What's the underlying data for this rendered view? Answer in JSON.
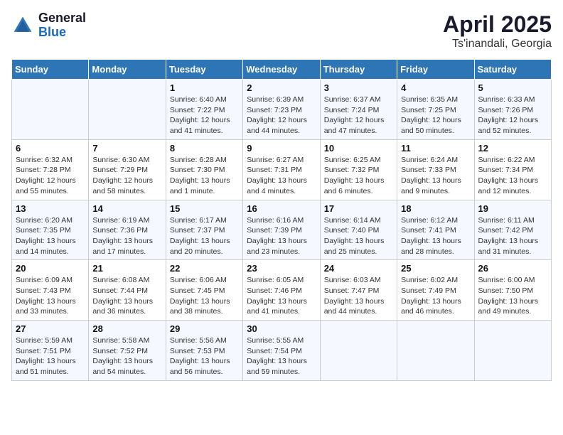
{
  "logo": {
    "general": "General",
    "blue": "Blue"
  },
  "title": "April 2025",
  "subtitle": "Ts'inandali, Georgia",
  "days_of_week": [
    "Sunday",
    "Monday",
    "Tuesday",
    "Wednesday",
    "Thursday",
    "Friday",
    "Saturday"
  ],
  "weeks": [
    [
      {
        "day": "",
        "info": ""
      },
      {
        "day": "",
        "info": ""
      },
      {
        "day": "1",
        "info": "Sunrise: 6:40 AM\nSunset: 7:22 PM\nDaylight: 12 hours and 41 minutes."
      },
      {
        "day": "2",
        "info": "Sunrise: 6:39 AM\nSunset: 7:23 PM\nDaylight: 12 hours and 44 minutes."
      },
      {
        "day": "3",
        "info": "Sunrise: 6:37 AM\nSunset: 7:24 PM\nDaylight: 12 hours and 47 minutes."
      },
      {
        "day": "4",
        "info": "Sunrise: 6:35 AM\nSunset: 7:25 PM\nDaylight: 12 hours and 50 minutes."
      },
      {
        "day": "5",
        "info": "Sunrise: 6:33 AM\nSunset: 7:26 PM\nDaylight: 12 hours and 52 minutes."
      }
    ],
    [
      {
        "day": "6",
        "info": "Sunrise: 6:32 AM\nSunset: 7:28 PM\nDaylight: 12 hours and 55 minutes."
      },
      {
        "day": "7",
        "info": "Sunrise: 6:30 AM\nSunset: 7:29 PM\nDaylight: 12 hours and 58 minutes."
      },
      {
        "day": "8",
        "info": "Sunrise: 6:28 AM\nSunset: 7:30 PM\nDaylight: 13 hours and 1 minute."
      },
      {
        "day": "9",
        "info": "Sunrise: 6:27 AM\nSunset: 7:31 PM\nDaylight: 13 hours and 4 minutes."
      },
      {
        "day": "10",
        "info": "Sunrise: 6:25 AM\nSunset: 7:32 PM\nDaylight: 13 hours and 6 minutes."
      },
      {
        "day": "11",
        "info": "Sunrise: 6:24 AM\nSunset: 7:33 PM\nDaylight: 13 hours and 9 minutes."
      },
      {
        "day": "12",
        "info": "Sunrise: 6:22 AM\nSunset: 7:34 PM\nDaylight: 13 hours and 12 minutes."
      }
    ],
    [
      {
        "day": "13",
        "info": "Sunrise: 6:20 AM\nSunset: 7:35 PM\nDaylight: 13 hours and 14 minutes."
      },
      {
        "day": "14",
        "info": "Sunrise: 6:19 AM\nSunset: 7:36 PM\nDaylight: 13 hours and 17 minutes."
      },
      {
        "day": "15",
        "info": "Sunrise: 6:17 AM\nSunset: 7:37 PM\nDaylight: 13 hours and 20 minutes."
      },
      {
        "day": "16",
        "info": "Sunrise: 6:16 AM\nSunset: 7:39 PM\nDaylight: 13 hours and 23 minutes."
      },
      {
        "day": "17",
        "info": "Sunrise: 6:14 AM\nSunset: 7:40 PM\nDaylight: 13 hours and 25 minutes."
      },
      {
        "day": "18",
        "info": "Sunrise: 6:12 AM\nSunset: 7:41 PM\nDaylight: 13 hours and 28 minutes."
      },
      {
        "day": "19",
        "info": "Sunrise: 6:11 AM\nSunset: 7:42 PM\nDaylight: 13 hours and 31 minutes."
      }
    ],
    [
      {
        "day": "20",
        "info": "Sunrise: 6:09 AM\nSunset: 7:43 PM\nDaylight: 13 hours and 33 minutes."
      },
      {
        "day": "21",
        "info": "Sunrise: 6:08 AM\nSunset: 7:44 PM\nDaylight: 13 hours and 36 minutes."
      },
      {
        "day": "22",
        "info": "Sunrise: 6:06 AM\nSunset: 7:45 PM\nDaylight: 13 hours and 38 minutes."
      },
      {
        "day": "23",
        "info": "Sunrise: 6:05 AM\nSunset: 7:46 PM\nDaylight: 13 hours and 41 minutes."
      },
      {
        "day": "24",
        "info": "Sunrise: 6:03 AM\nSunset: 7:47 PM\nDaylight: 13 hours and 44 minutes."
      },
      {
        "day": "25",
        "info": "Sunrise: 6:02 AM\nSunset: 7:49 PM\nDaylight: 13 hours and 46 minutes."
      },
      {
        "day": "26",
        "info": "Sunrise: 6:00 AM\nSunset: 7:50 PM\nDaylight: 13 hours and 49 minutes."
      }
    ],
    [
      {
        "day": "27",
        "info": "Sunrise: 5:59 AM\nSunset: 7:51 PM\nDaylight: 13 hours and 51 minutes."
      },
      {
        "day": "28",
        "info": "Sunrise: 5:58 AM\nSunset: 7:52 PM\nDaylight: 13 hours and 54 minutes."
      },
      {
        "day": "29",
        "info": "Sunrise: 5:56 AM\nSunset: 7:53 PM\nDaylight: 13 hours and 56 minutes."
      },
      {
        "day": "30",
        "info": "Sunrise: 5:55 AM\nSunset: 7:54 PM\nDaylight: 13 hours and 59 minutes."
      },
      {
        "day": "",
        "info": ""
      },
      {
        "day": "",
        "info": ""
      },
      {
        "day": "",
        "info": ""
      }
    ]
  ]
}
